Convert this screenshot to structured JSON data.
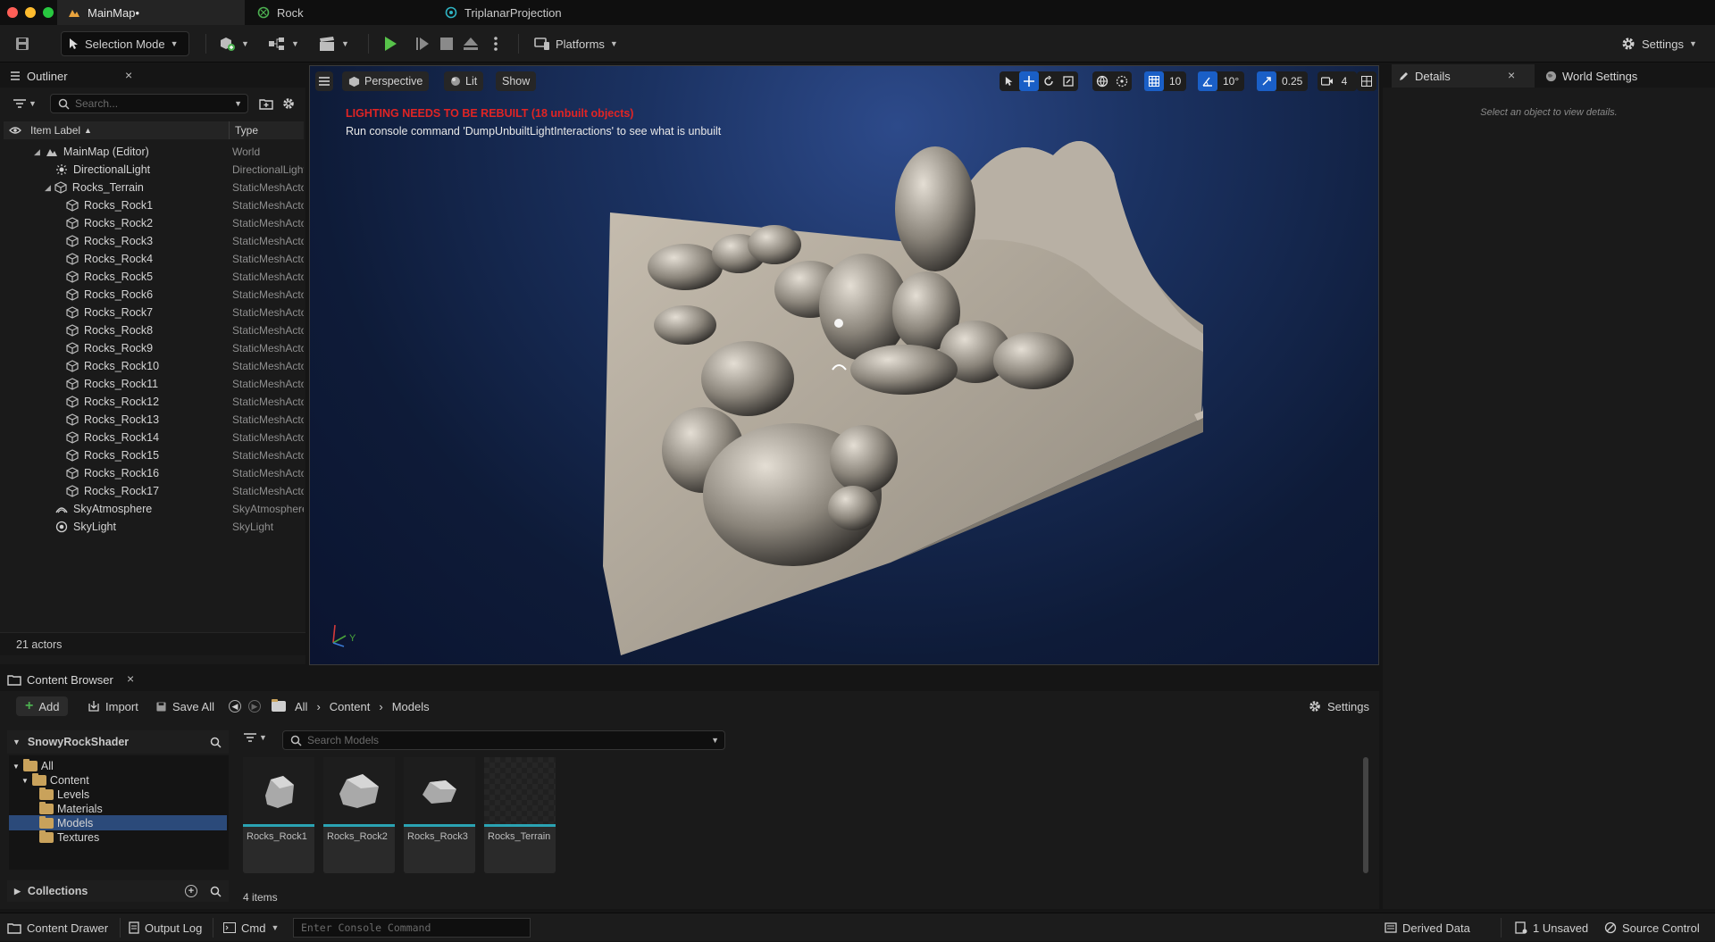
{
  "titlebar": {
    "tabs": [
      {
        "label": "MainMap•",
        "icon": "level-icon"
      },
      {
        "label": "Rock",
        "icon": "material-icon"
      },
      {
        "label": "TriplanarProjection",
        "icon": "material-function-icon"
      }
    ]
  },
  "toolbar": {
    "selection_mode": "Selection Mode",
    "platforms": "Platforms",
    "settings": "Settings"
  },
  "outliner": {
    "tab_label": "Outliner",
    "search_placeholder": "Search...",
    "col_label": "Item Label",
    "col_type": "Type",
    "rows": [
      {
        "label": "MainMap (Editor)",
        "type": "World"
      },
      {
        "label": "DirectionalLight",
        "type": "DirectionalLight"
      },
      {
        "label": "Rocks_Terrain",
        "type": "StaticMeshActor"
      },
      {
        "label": "Rocks_Rock1",
        "type": "StaticMeshActor"
      },
      {
        "label": "Rocks_Rock2",
        "type": "StaticMeshActor"
      },
      {
        "label": "Rocks_Rock3",
        "type": "StaticMeshActor"
      },
      {
        "label": "Rocks_Rock4",
        "type": "StaticMeshActor"
      },
      {
        "label": "Rocks_Rock5",
        "type": "StaticMeshActor"
      },
      {
        "label": "Rocks_Rock6",
        "type": "StaticMeshActor"
      },
      {
        "label": "Rocks_Rock7",
        "type": "StaticMeshActor"
      },
      {
        "label": "Rocks_Rock8",
        "type": "StaticMeshActor"
      },
      {
        "label": "Rocks_Rock9",
        "type": "StaticMeshActor"
      },
      {
        "label": "Rocks_Rock10",
        "type": "StaticMeshActor"
      },
      {
        "label": "Rocks_Rock11",
        "type": "StaticMeshActor"
      },
      {
        "label": "Rocks_Rock12",
        "type": "StaticMeshActor"
      },
      {
        "label": "Rocks_Rock13",
        "type": "StaticMeshActor"
      },
      {
        "label": "Rocks_Rock14",
        "type": "StaticMeshActor"
      },
      {
        "label": "Rocks_Rock15",
        "type": "StaticMeshActor"
      },
      {
        "label": "Rocks_Rock16",
        "type": "StaticMeshActor"
      },
      {
        "label": "Rocks_Rock17",
        "type": "StaticMeshActor"
      },
      {
        "label": "SkyAtmosphere",
        "type": "SkyAtmosphere"
      },
      {
        "label": "SkyLight",
        "type": "SkyLight"
      }
    ],
    "actor_count": "21 actors"
  },
  "viewport": {
    "perspective": "Perspective",
    "lit": "Lit",
    "show": "Show",
    "grid_snap": "10",
    "rot_snap": "10°",
    "scale_snap": "0.25",
    "cam_speed": "4",
    "warning": "LIGHTING NEEDS TO BE REBUILT (18 unbuilt objects)",
    "hint": "Run console command 'DumpUnbuiltLightInteractions' to see what is unbuilt"
  },
  "details": {
    "tab_details": "Details",
    "tab_world": "World Settings",
    "empty_msg": "Select an object to view details."
  },
  "content_browser": {
    "tab_label": "Content Browser",
    "add": "Add",
    "import": "Import",
    "save_all": "Save All",
    "crumbs": [
      "All",
      "Content",
      "Models"
    ],
    "settings": "Settings",
    "project": "SnowyRockShader",
    "search_placeholder": "Search Models",
    "tree": [
      "All",
      "Content",
      "Levels",
      "Materials",
      "Models",
      "Textures"
    ],
    "collections": "Collections",
    "assets": [
      "Rocks_Rock1",
      "Rocks_Rock2",
      "Rocks_Rock3",
      "Rocks_Terrain"
    ],
    "item_count": "4 items"
  },
  "statusbar": {
    "content_drawer": "Content Drawer",
    "output_log": "Output Log",
    "cmd": "Cmd",
    "console_placeholder": "Enter Console Command",
    "derived_data": "Derived Data",
    "unsaved": "1 Unsaved",
    "source_control": "Source Control"
  },
  "colors": {
    "accent_green": "#4caf50",
    "accent_blue": "#1a73e8",
    "warning_red": "#d32020",
    "selection": "#2b4a7a"
  }
}
